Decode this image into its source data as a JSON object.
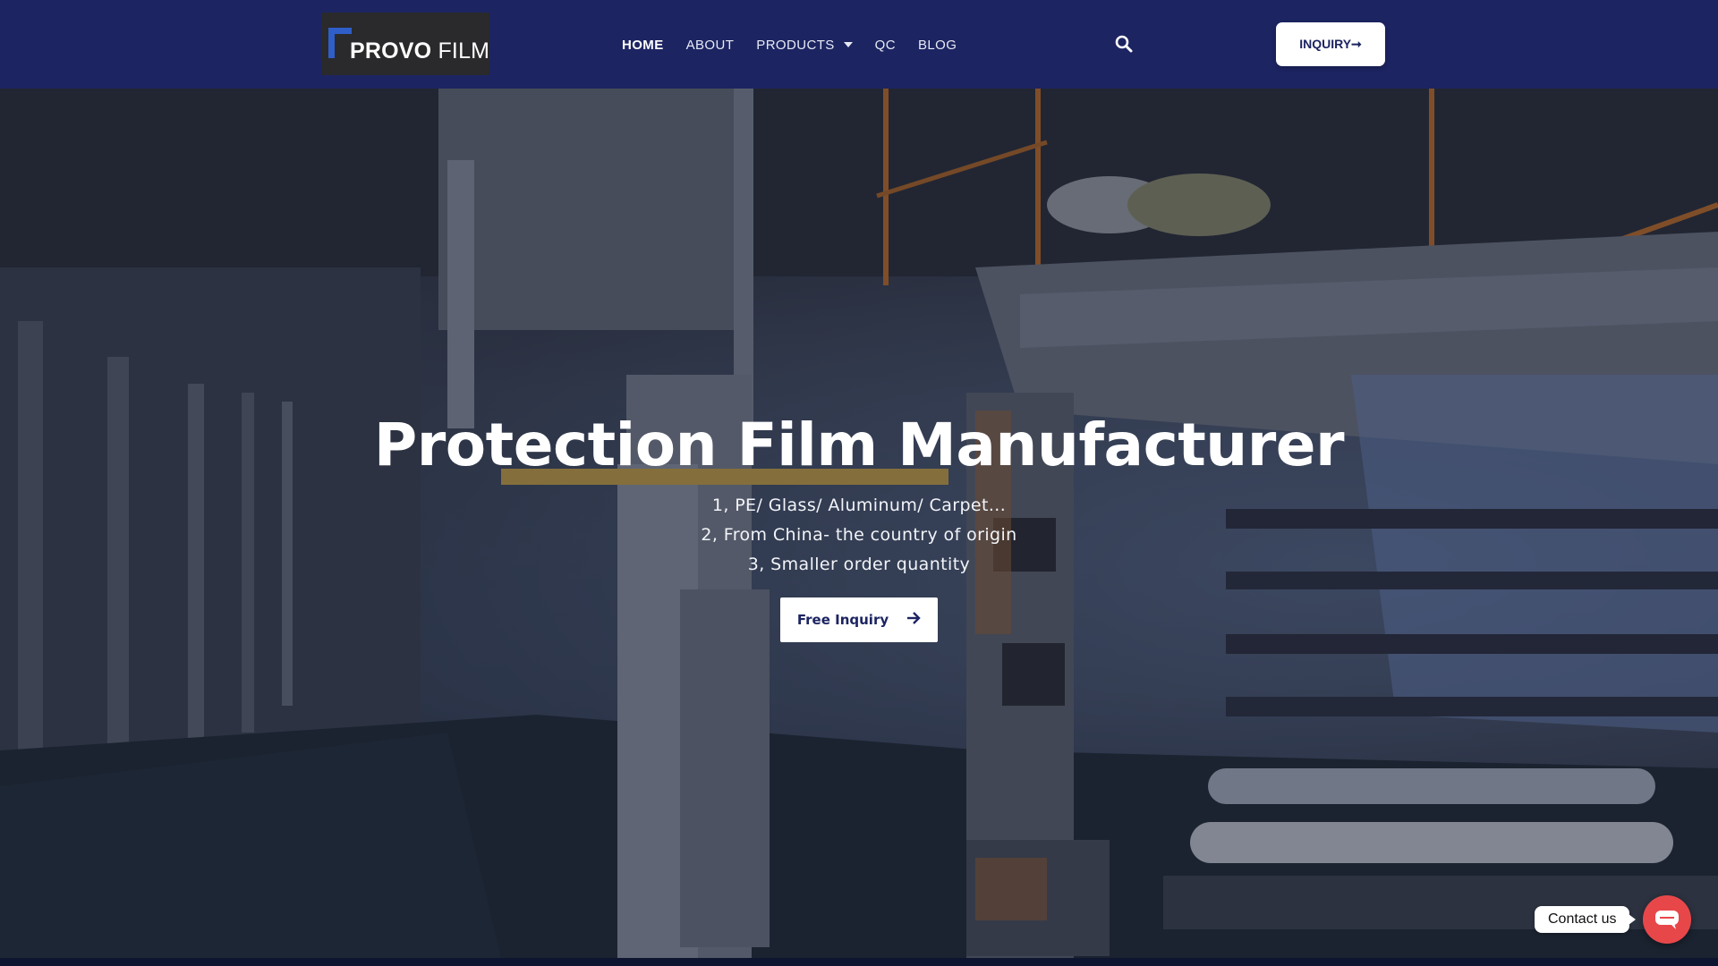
{
  "header": {
    "logo": {
      "brand_bold": "PROVO",
      "brand_light": "FILM"
    },
    "nav": [
      {
        "label": "HOME"
      },
      {
        "label": "ABOUT"
      },
      {
        "label": "PRODUCTS"
      },
      {
        "label": "QC"
      },
      {
        "label": "BLOG"
      }
    ],
    "search_icon": "search-icon",
    "inquiry_button": {
      "label": "INQUIRY➞"
    }
  },
  "hero": {
    "title": "Protection Film Manufacturer",
    "lines": [
      "1, PE/ Glass/ Aluminum/ Carpet...",
      "2, From China- the country of origin",
      "3, Smaller order quantity"
    ],
    "cta": {
      "label": "Free Inquiry",
      "icon": "arrow-right-icon"
    }
  },
  "contact_widget": {
    "label": "Contact us",
    "icon": "chat-bubble-icon"
  },
  "colors": {
    "header_bg": "#1c2462",
    "button_bg": "#ffffff",
    "button_text": "#1c2462",
    "contact_accent": "#e8474a"
  }
}
